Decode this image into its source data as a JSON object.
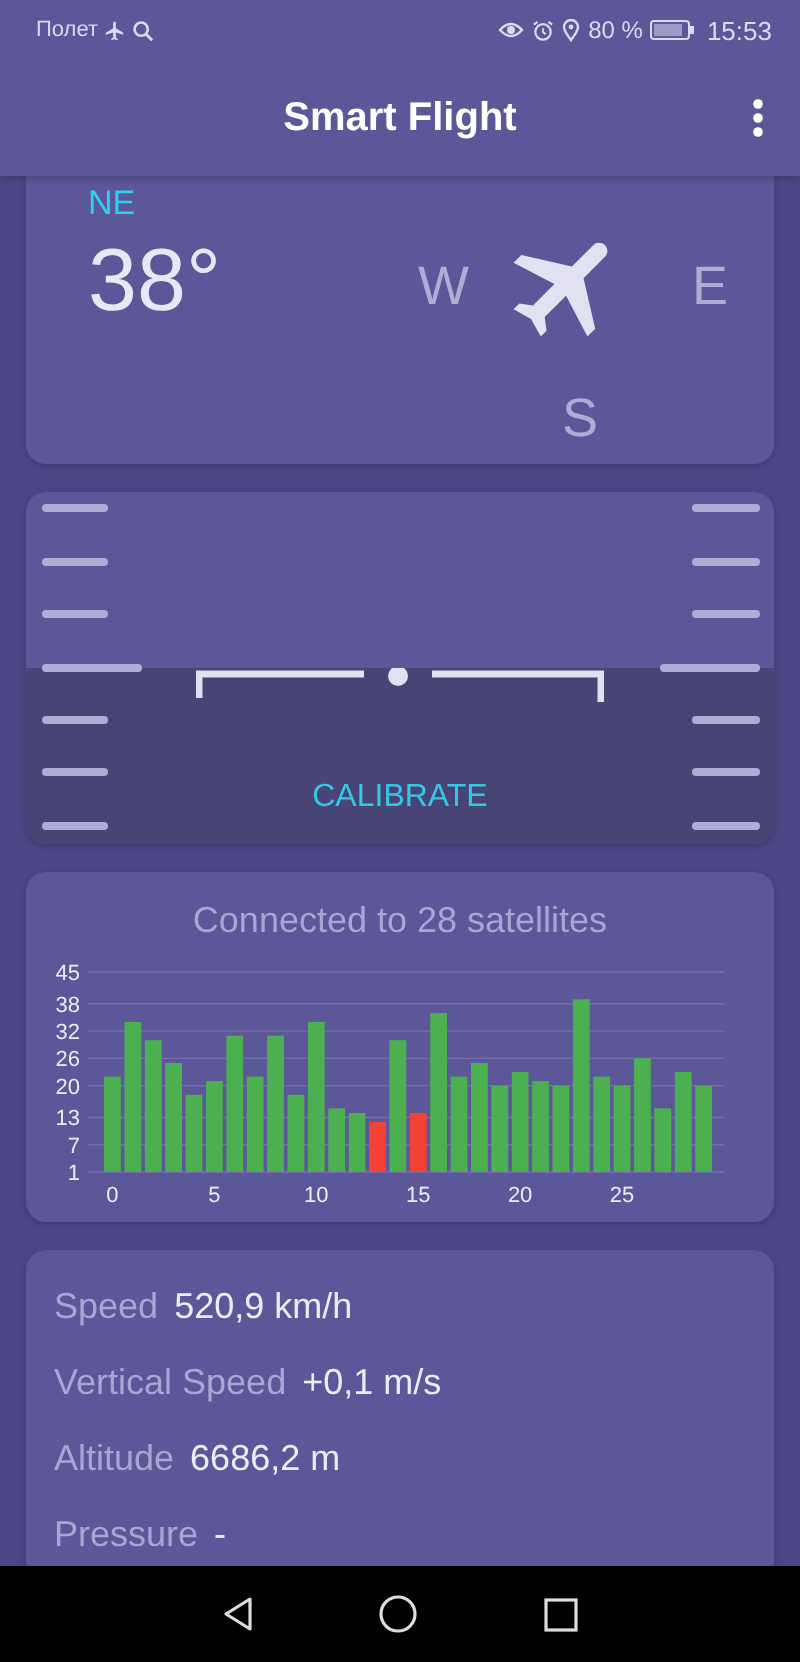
{
  "status_bar": {
    "mode_label": "Полет",
    "battery": "80 %",
    "time": "15:53"
  },
  "app_bar": {
    "title": "Smart Flight"
  },
  "compass": {
    "direction": "NE",
    "heading": "38°",
    "west": "W",
    "east": "E",
    "south": "S"
  },
  "horizon": {
    "button": "CALIBRATE"
  },
  "satellites": {
    "title": "Connected to 28 satellites",
    "chart_data": {
      "type": "bar",
      "grid": true,
      "stacked": true,
      "xlim": [
        -1.2,
        30
      ],
      "x": [
        0,
        1,
        2,
        3,
        4,
        5,
        6,
        7,
        8,
        9,
        10,
        11,
        12,
        13,
        14,
        15,
        16,
        17,
        18,
        19,
        20,
        21,
        22,
        23,
        24,
        25,
        26,
        27,
        28,
        29
      ],
      "ylim": [
        1,
        45
      ],
      "yticks": [
        1,
        7,
        13,
        20,
        26,
        32,
        38,
        45
      ],
      "xticks": [
        0,
        5,
        10,
        15,
        20,
        25
      ],
      "series": [
        {
          "color": "#4caf50",
          "values": [
            22,
            34,
            30,
            25,
            18,
            21,
            31,
            22,
            31,
            18,
            34,
            15,
            14,
            null,
            30,
            null,
            36,
            22,
            25,
            20,
            23,
            21,
            20,
            39,
            22,
            20,
            26,
            15,
            23,
            20
          ]
        },
        {
          "color": "#f44336",
          "values": [
            null,
            null,
            null,
            null,
            null,
            null,
            null,
            null,
            null,
            null,
            null,
            null,
            null,
            12,
            null,
            14,
            null,
            null,
            null,
            null,
            null,
            null,
            null,
            null,
            null,
            null,
            null,
            null,
            null,
            null
          ]
        }
      ]
    }
  },
  "info": [
    {
      "label": "Speed",
      "value": "520,9 km/h"
    },
    {
      "label": "Vertical Speed",
      "value": "+0,1 m/s"
    },
    {
      "label": "Altitude",
      "value": "6686,2 m"
    },
    {
      "label": "Pressure",
      "value": "-"
    }
  ]
}
